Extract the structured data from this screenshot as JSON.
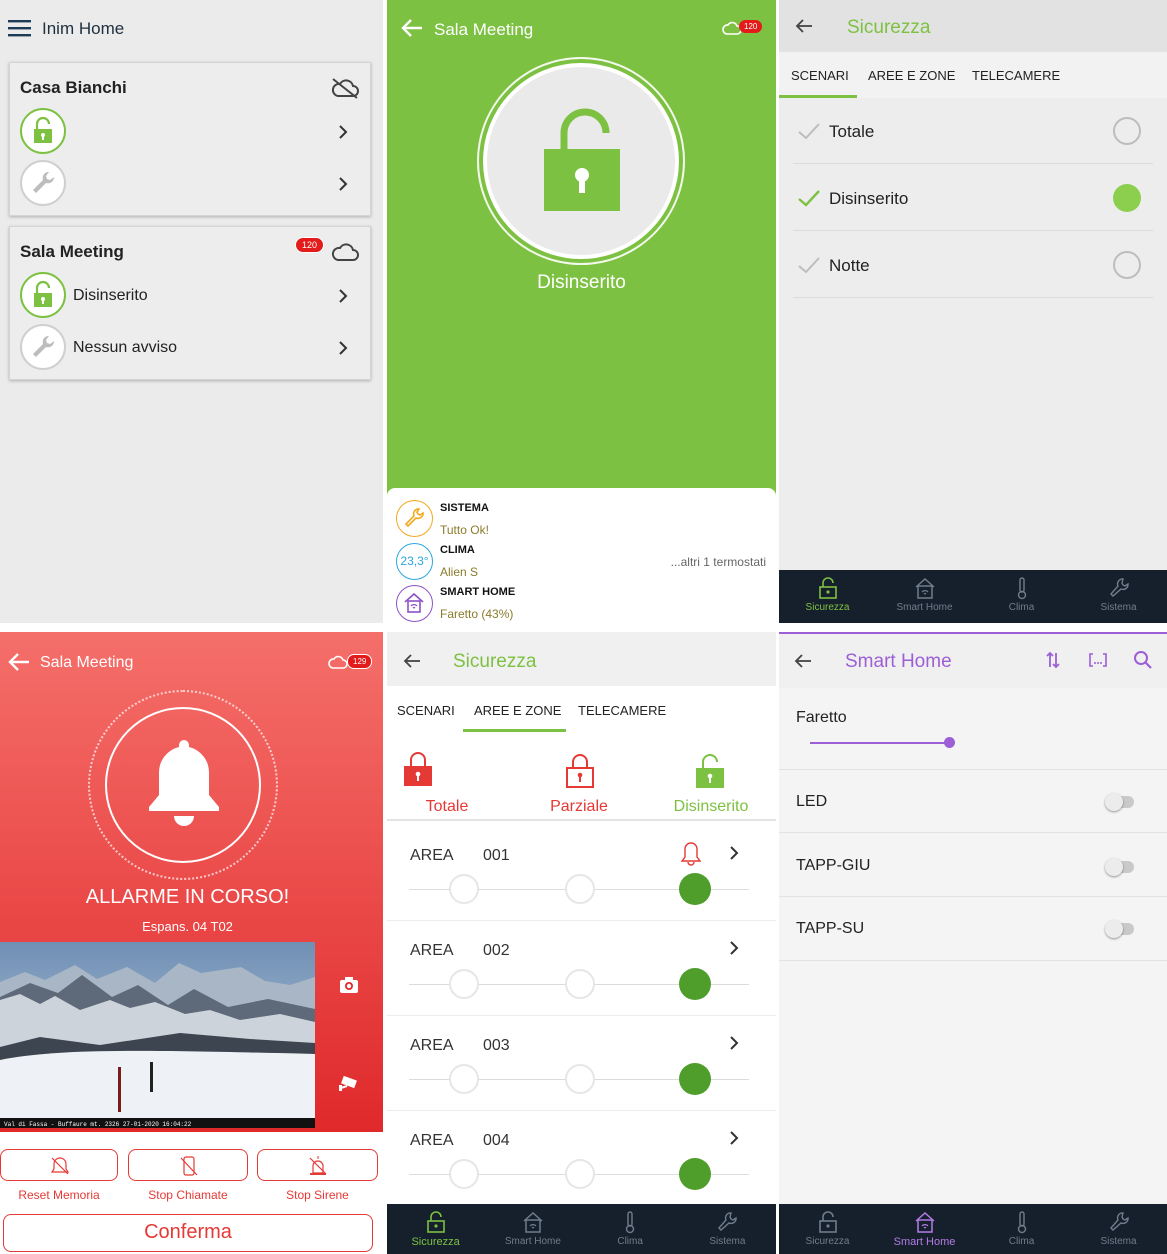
{
  "home": {
    "title": "Inim Home",
    "cards": [
      {
        "name": "Casa Bianchi",
        "rows": [
          "",
          ""
        ]
      },
      {
        "name": "Sala Meeting",
        "badge": "120",
        "rows": [
          "Disinserito",
          "Nessun avviso"
        ]
      }
    ]
  },
  "sala": {
    "title": "Sala Meeting",
    "badge": "120",
    "status": "Disinserito",
    "summary": [
      {
        "title": "SISTEMA",
        "value": "Tutto Ok!",
        "color": "#f2a91e"
      },
      {
        "title": "CLIMA",
        "value": "Alien S",
        "temp": "23,3°",
        "color": "#2aa7df"
      },
      {
        "title": "SMART HOME",
        "value": "Faretto (43%)",
        "color": "#8e52c8"
      }
    ],
    "extra": "...altri 1 termostati"
  },
  "sicurezza_scenari": {
    "title": "Sicurezza",
    "tabs": [
      "SCENARI",
      "AREE E ZONE",
      "TELECAMERE"
    ],
    "active_tab": "SCENARI",
    "scenarios": [
      {
        "label": "Totale",
        "selected": false
      },
      {
        "label": "Disinserito",
        "selected": true
      },
      {
        "label": "Notte",
        "selected": false
      }
    ]
  },
  "bottom_nav": [
    "Sicurezza",
    "Smart Home",
    "Clima",
    "Sistema"
  ],
  "alarm": {
    "title": "Sala Meeting",
    "badge": "129",
    "headline": "ALLARME IN CORSO!",
    "source": "Espans.  04 T02",
    "camera_caption": "Val di Fassa - Buffaure mt. 2326 27-01-2020 16:04:22",
    "actions": [
      "Reset Memoria",
      "Stop Chiamate",
      "Stop Sirene"
    ],
    "confirm": "Conferma"
  },
  "sicurezza_aree": {
    "title": "Sicurezza",
    "tabs": [
      "SCENARI",
      "AREE E ZONE",
      "TELECAMERE"
    ],
    "active_tab": "AREE E ZONE",
    "modes": [
      "Totale",
      "Parziale",
      "Disinserito"
    ],
    "area_label": "AREA",
    "areas": [
      {
        "id": "001",
        "alarm": true
      },
      {
        "id": "002",
        "alarm": false
      },
      {
        "id": "003",
        "alarm": false
      },
      {
        "id": "004",
        "alarm": false
      }
    ]
  },
  "smart_home": {
    "title": "Smart Home",
    "items": [
      {
        "label": "Faretto",
        "type": "slider",
        "level": 0.43
      },
      {
        "label": "LED",
        "type": "toggle",
        "on": false
      },
      {
        "label": "TAPP-GIU",
        "type": "toggle",
        "on": false
      },
      {
        "label": "TAPP-SU",
        "type": "toggle",
        "on": false
      }
    ]
  },
  "colors": {
    "green": "#7dc142",
    "red": "#e53935",
    "purple": "#9c5fd6",
    "navy": "#16202c"
  }
}
